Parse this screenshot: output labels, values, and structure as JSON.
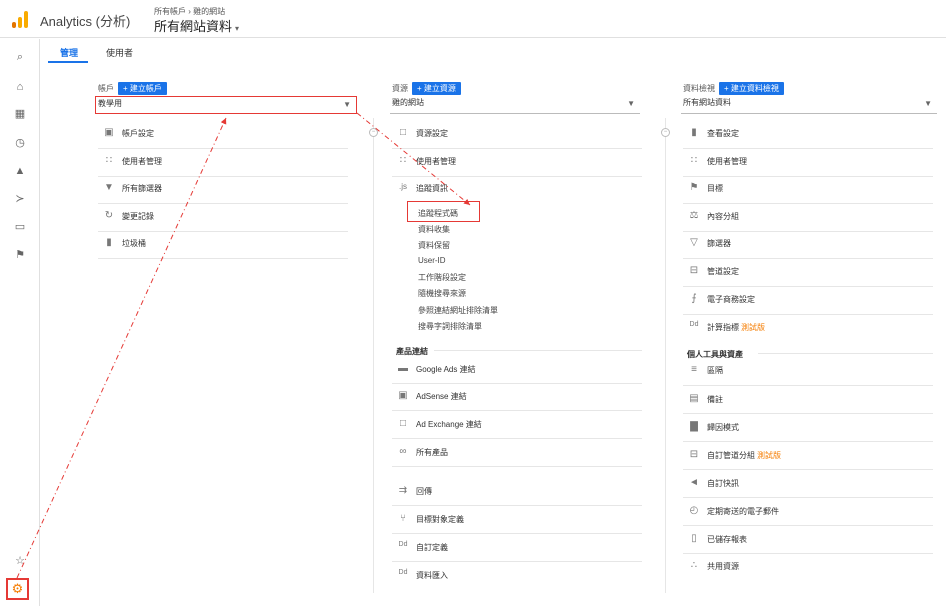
{
  "header": {
    "app_title": "Analytics (分析)",
    "breadcrumb": "所有帳戶 › 雞的網站",
    "view_name": "所有網站資料",
    "colors": {
      "logo_orange": "#f9ab00",
      "logo_dark": "#e37400",
      "accent": "#1a73e8",
      "highlight_red": "#e53935"
    }
  },
  "rail": {
    "icons": [
      "search-icon",
      "home-icon",
      "dashboard-icon",
      "clock-icon",
      "person-icon",
      "acquisition-icon",
      "behavior-icon",
      "flag-icon",
      "lightbulb-icon",
      "gear-icon"
    ]
  },
  "tabs": {
    "admin": "管理",
    "user": "使用者"
  },
  "account": {
    "header_label": "帳戶",
    "create_button": "+ 建立帳戶",
    "selected": "教學用",
    "items": [
      "帳戶設定",
      "使用者管理",
      "所有篩選器",
      "變更記錄",
      "垃圾桶"
    ]
  },
  "property": {
    "header_label": "資源",
    "create_button": "+ 建立資源",
    "selected": "雞的網站",
    "items": [
      "資源設定",
      "使用者管理",
      "追蹤資訊"
    ],
    "tracking_sub": [
      "追蹤程式碼",
      "資料收集",
      "資料保留",
      "User-ID",
      "工作階段設定",
      "隨機搜尋來源",
      "參照連結網址排除清單",
      "搜尋字詞排除清單"
    ],
    "product_linking_title": "產品連結",
    "product_links": [
      "Google Ads 連結",
      "AdSense 連結",
      "Ad Exchange 連結",
      "所有產品"
    ],
    "more_items": [
      "回傳",
      "目標對象定義",
      "自訂定義",
      "資料匯入"
    ]
  },
  "view": {
    "header_label": "資料檢視",
    "create_button": "+ 建立資料檢視",
    "selected": "所有網站資料",
    "items": [
      "查看設定",
      "使用者管理",
      "目標",
      "內容分組",
      "篩選器",
      "管道設定",
      "電子商務設定",
      "計算指標"
    ],
    "beta_label": "測試版",
    "personal_title": "個人工具與資產",
    "personal_items": [
      "區隔",
      "備註",
      "歸因模式",
      "自訂管道分組",
      "自訂快訊",
      "定期寄送的電子郵件",
      "已儲存報表",
      "共用資源"
    ]
  }
}
